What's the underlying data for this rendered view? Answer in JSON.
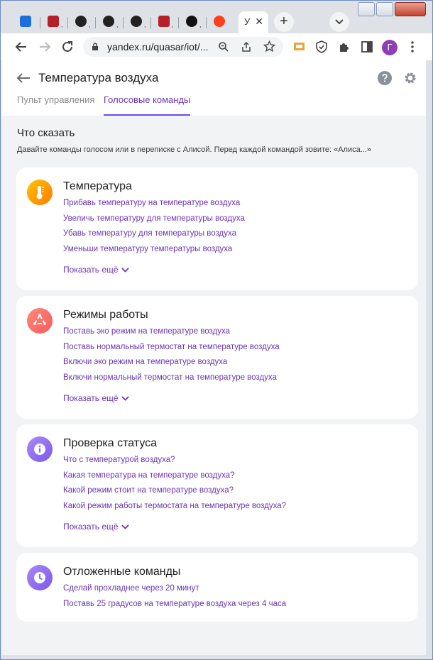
{
  "browser": {
    "active_tab_label": "У",
    "url": "yandex.ru/quasar/iot/...",
    "avatar_letter": "Г"
  },
  "page": {
    "title": "Температура воздуха",
    "tabs": [
      {
        "label": "Пульт управления"
      },
      {
        "label": "Голосовые команды"
      }
    ],
    "section_title": "Что сказать",
    "section_subtitle": "Давайте команды голосом или в переписке с Алисой. Перед каждой командой зовите: «Алиса...»",
    "show_more_label": "Показать ещё"
  },
  "cards": [
    {
      "title": "Температура",
      "icon": "thermometer-icon",
      "color": "#ff9a00",
      "commands": [
        "Прибавь температуру на температуре воздуха",
        "Увеличь температуру для температуры воздуха",
        "Убавь температуру для температуры воздуха",
        "Уменьши температуру температуры воздуха"
      ]
    },
    {
      "title": "Режимы работы",
      "icon": "cycle-icon",
      "color": "#ff6b6b",
      "commands": [
        "Поставь эко режим на температуре воздуха",
        "Поставь нормальный термостат на температуре воздуха",
        "Включи эко режим на температуре воздуха",
        "Включи нормальный термостат на температуре воздуха"
      ]
    },
    {
      "title": "Проверка статуса",
      "icon": "info-icon",
      "color": "#8c6cf0",
      "commands": [
        "Что с температурой воздуха?",
        "Какая температура на температуре воздуха?",
        "Какой режим стоит на температуре воздуха?",
        "Какой режим работы термостата на температуре воздуха?"
      ]
    },
    {
      "title": "Отложенные команды",
      "icon": "clock-icon",
      "color": "#8c6cf0",
      "commands": [
        "Сделай прохладнее через 20 минут",
        "Поставь 25 градусов на температуре воздуха через 4 часа"
      ]
    }
  ]
}
